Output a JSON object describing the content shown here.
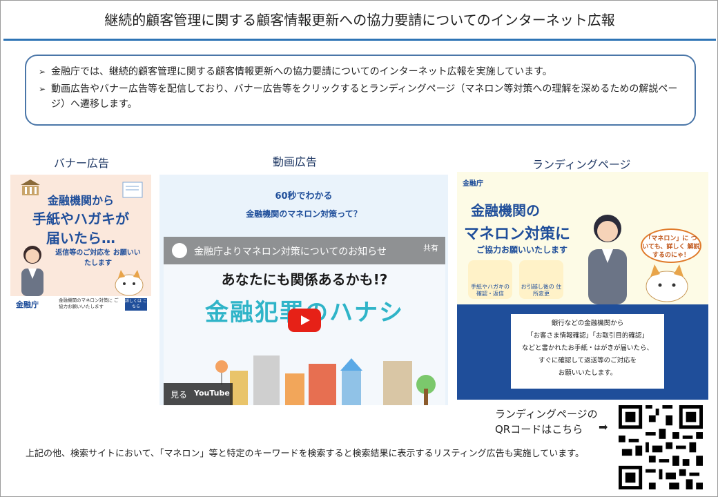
{
  "title": "継続的顧客管理に関する顧客情報更新への協力要請についてのインターネット広報",
  "bullets": [
    "金融庁では、継続的顧客管理に関する顧客情報更新への協力要請についてのインターネット広報を実施しています。",
    "動画広告やバナー広告等を配信しており、バナー広告等をクリックするとランディングページ（マネロン等対策への理解を深めるための解説ページ）へ遷移します。"
  ],
  "sections": {
    "banner": "バナー広告",
    "video": "動画広告",
    "landing": "ランディングページ"
  },
  "banner_ad": {
    "line1": "金融機関から",
    "line2": "手紙やハガキが",
    "line3": "届いたら…",
    "sub": "返信等のご対応を お願いいたします",
    "logo": "金融庁",
    "footer_text": "金融機関のマネロン対策に ご協力お願いいたします",
    "button": "詳しくは こちら"
  },
  "video_ad": {
    "line1": "60秒でわかる",
    "line2": "金融機関のマネロン対策って？",
    "video_title": "金融庁よりマネロン対策についてのお知らせ",
    "share": "共有",
    "headline": "あなたにも関係あるかも!?",
    "big_text": "金融犯罪のハナシ",
    "watch": "見る",
    "youtube": "YouTube"
  },
  "landing_page": {
    "logo": "金融庁",
    "line1": "金融機関の",
    "line2": "マネロン対策に",
    "line3": "ご協力お願いいたします",
    "card1": "手紙やハガキの 確認・返信",
    "card2": "お引越し後の 住所変更",
    "bubble": "「マネロン」に ついても、詳しく 解説するのにゃ！",
    "notice_lines": [
      "銀行などの金融機関から",
      "「お客さま情報確認」「お取引目的確認」",
      "などと書かれたお手紙・はがきが届いたら、",
      "すぐに確認して返送等のご対応を",
      "お願いいたします。"
    ]
  },
  "qr": {
    "label_line1": "ランディングページの",
    "label_line2": "QRコードはこちら",
    "arrow": "➡"
  },
  "bottom_note": "上記の他、検索サイトにおいて、「マネロン」等と特定のキーワードを検索すると検索結果に表示するリスティング広告も実施しています。"
}
